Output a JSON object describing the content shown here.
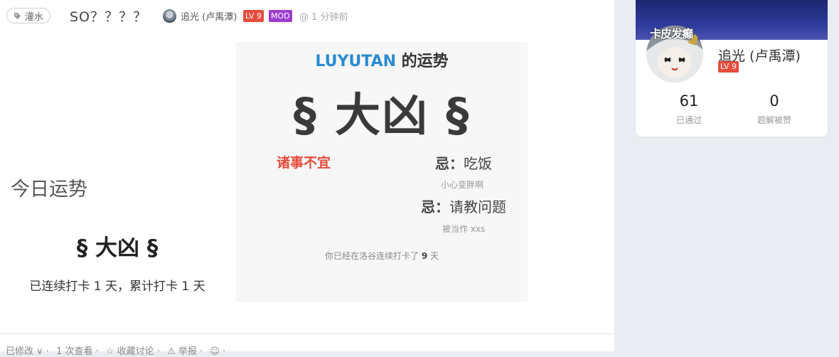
{
  "post": {
    "tag": "灌水",
    "title": "SO？？？？",
    "author": "追光 (卢禹潭)",
    "level_badge": "LV 9",
    "mod_badge": "MOD",
    "time": "@ 1 分钟前"
  },
  "fortune": {
    "heading": "今日运势",
    "result": "§ 大凶 §",
    "checkin": "已连续打卡 1 天，累计打卡 1 天"
  },
  "panel": {
    "title_user": "LUYUTAN",
    "title_suffix": " 的运势",
    "big_result": "§ 大凶 §",
    "good": "诸事不宜",
    "avoid1_label": "忌：",
    "avoid1_value": "吃饭",
    "avoid1_note": "小心变胖啊",
    "avoid2_label": "忌：",
    "avoid2_value": "请教问题",
    "avoid2_note": "被当作 xxs",
    "streak_prefix": "你已经在洛谷连续打卡了 ",
    "streak_days": "9",
    "streak_suffix": " 天"
  },
  "footer": {
    "actions": [
      "已修改 ∨ ·",
      "1 次查看 ·",
      "☆ 收藏讨论 ·",
      "⚠ 举报 ·",
      "☺ ·"
    ]
  },
  "profile": {
    "banner_text": "卡皮发癫",
    "name": "追光 (卢禹潭)",
    "level": "LV 9",
    "stats": [
      {
        "value": "61",
        "label": "已通过"
      },
      {
        "value": "0",
        "label": "题解被赞"
      }
    ]
  },
  "colors": {
    "accent_blue": "#2a8bd2",
    "bad_red": "#e74c3c",
    "mod_purple": "#9d3dcf",
    "banner_navy": "#1c2670"
  }
}
